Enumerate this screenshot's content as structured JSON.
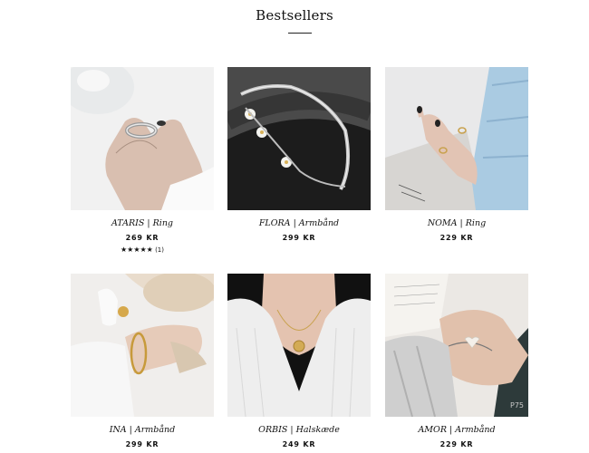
{
  "section": {
    "title": "Bestsellers"
  },
  "products": [
    {
      "name": "ATARIS | Ring",
      "price": "269 KR",
      "rating": {
        "stars": "★★★★★",
        "count": "(1)",
        "value": 5
      }
    },
    {
      "name": "FLORA | Armbånd",
      "price": "299 KR"
    },
    {
      "name": "NOMA | Ring",
      "price": "229 KR"
    },
    {
      "name": "INA | Armbånd",
      "price": "299 KR"
    },
    {
      "name": "ORBIS | Halskæde",
      "price": "249 KR"
    },
    {
      "name": "AMOR | Armbånd",
      "price": "229 KR"
    }
  ],
  "colors": {
    "text": "#111111",
    "background": "#ffffff"
  }
}
